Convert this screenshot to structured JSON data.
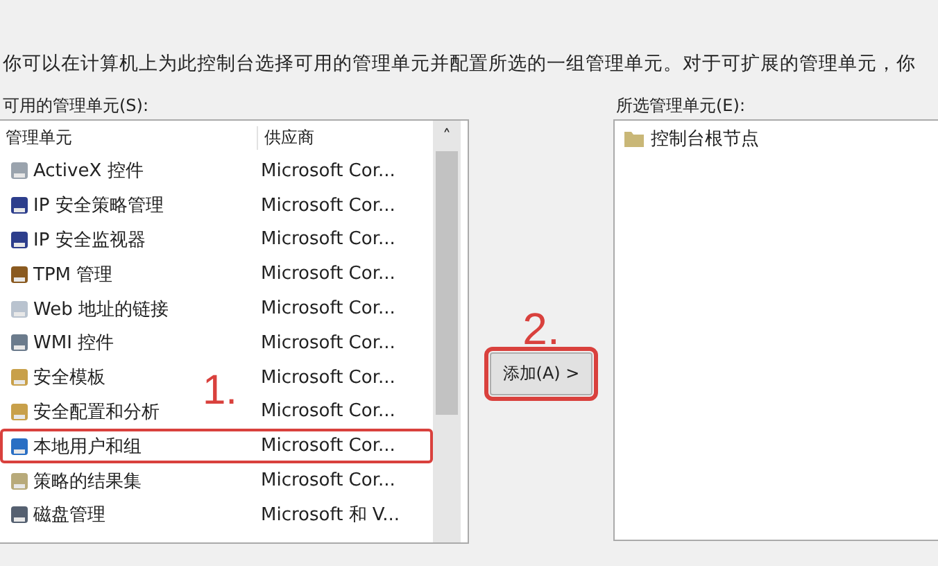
{
  "intro": "你可以在计算机上为此控制台选择可用的管理单元并配置所选的一组管理单元。对于可扩展的管理单元，你",
  "available": {
    "label": "可用的管理单元(S):",
    "columns": [
      "管理单元",
      "供应商"
    ],
    "sort_arrow": "˄",
    "rows": [
      {
        "name": "ActiveX 控件",
        "vendor": "Microsoft Cor...",
        "selected": false,
        "marked": false
      },
      {
        "name": "IP 安全策略管理",
        "vendor": "Microsoft Cor...",
        "selected": false,
        "marked": false
      },
      {
        "name": "IP 安全监视器",
        "vendor": "Microsoft Cor...",
        "selected": false,
        "marked": false
      },
      {
        "name": "TPM 管理",
        "vendor": "Microsoft Cor...",
        "selected": false,
        "marked": false
      },
      {
        "name": "Web 地址的链接",
        "vendor": "Microsoft Cor...",
        "selected": false,
        "marked": false
      },
      {
        "name": "WMI 控件",
        "vendor": "Microsoft Cor...",
        "selected": false,
        "marked": false
      },
      {
        "name": "安全模板",
        "vendor": "Microsoft Cor...",
        "selected": false,
        "marked": false
      },
      {
        "name": "安全配置和分析",
        "vendor": "Microsoft Cor...",
        "selected": false,
        "marked": false
      },
      {
        "name": "本地用户和组",
        "vendor": "Microsoft Cor...",
        "selected": false,
        "marked": true
      },
      {
        "name": "策略的结果集",
        "vendor": "Microsoft Cor...",
        "selected": false,
        "marked": false
      },
      {
        "name": "磁盘管理",
        "vendor": "Microsoft 和 V...",
        "selected": false,
        "marked": false
      }
    ]
  },
  "step1": "1.",
  "add_button": {
    "label": "添加(A) >",
    "marked": true
  },
  "step2": "2.",
  "selected_list": {
    "label": "所选管理单元(E):",
    "items": [
      "控制台根节点"
    ]
  }
}
